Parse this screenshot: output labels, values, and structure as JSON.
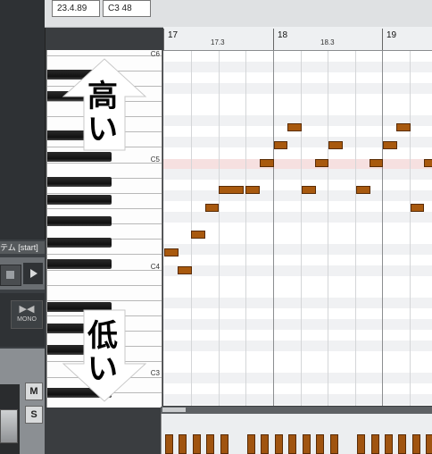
{
  "top_bar": {
    "position": "23.4.89",
    "note": "C3  48"
  },
  "ruler": {
    "bar_17": "17",
    "sub_17_3": "17.3",
    "bar_18": "18",
    "sub_18_3": "18.3",
    "bar_19": "19"
  },
  "keyboard": {
    "c6": "C6",
    "c5": "C5",
    "c4": "C4",
    "c3": "C3"
  },
  "annotations": {
    "high": "高い",
    "low": "低い"
  },
  "left_panel": {
    "track_label": "テム [start]",
    "mono_label": "MONO",
    "mute_label": "M",
    "solo_label": "S"
  },
  "colors": {
    "note": "#a8590e",
    "c5_row_highlight": "#f6e0e0",
    "arrow": "#ffffff"
  },
  "icons": [
    "stop-icon",
    "play-icon",
    "mono-icon",
    "up-arrow-icon",
    "down-arrow-icon"
  ]
}
